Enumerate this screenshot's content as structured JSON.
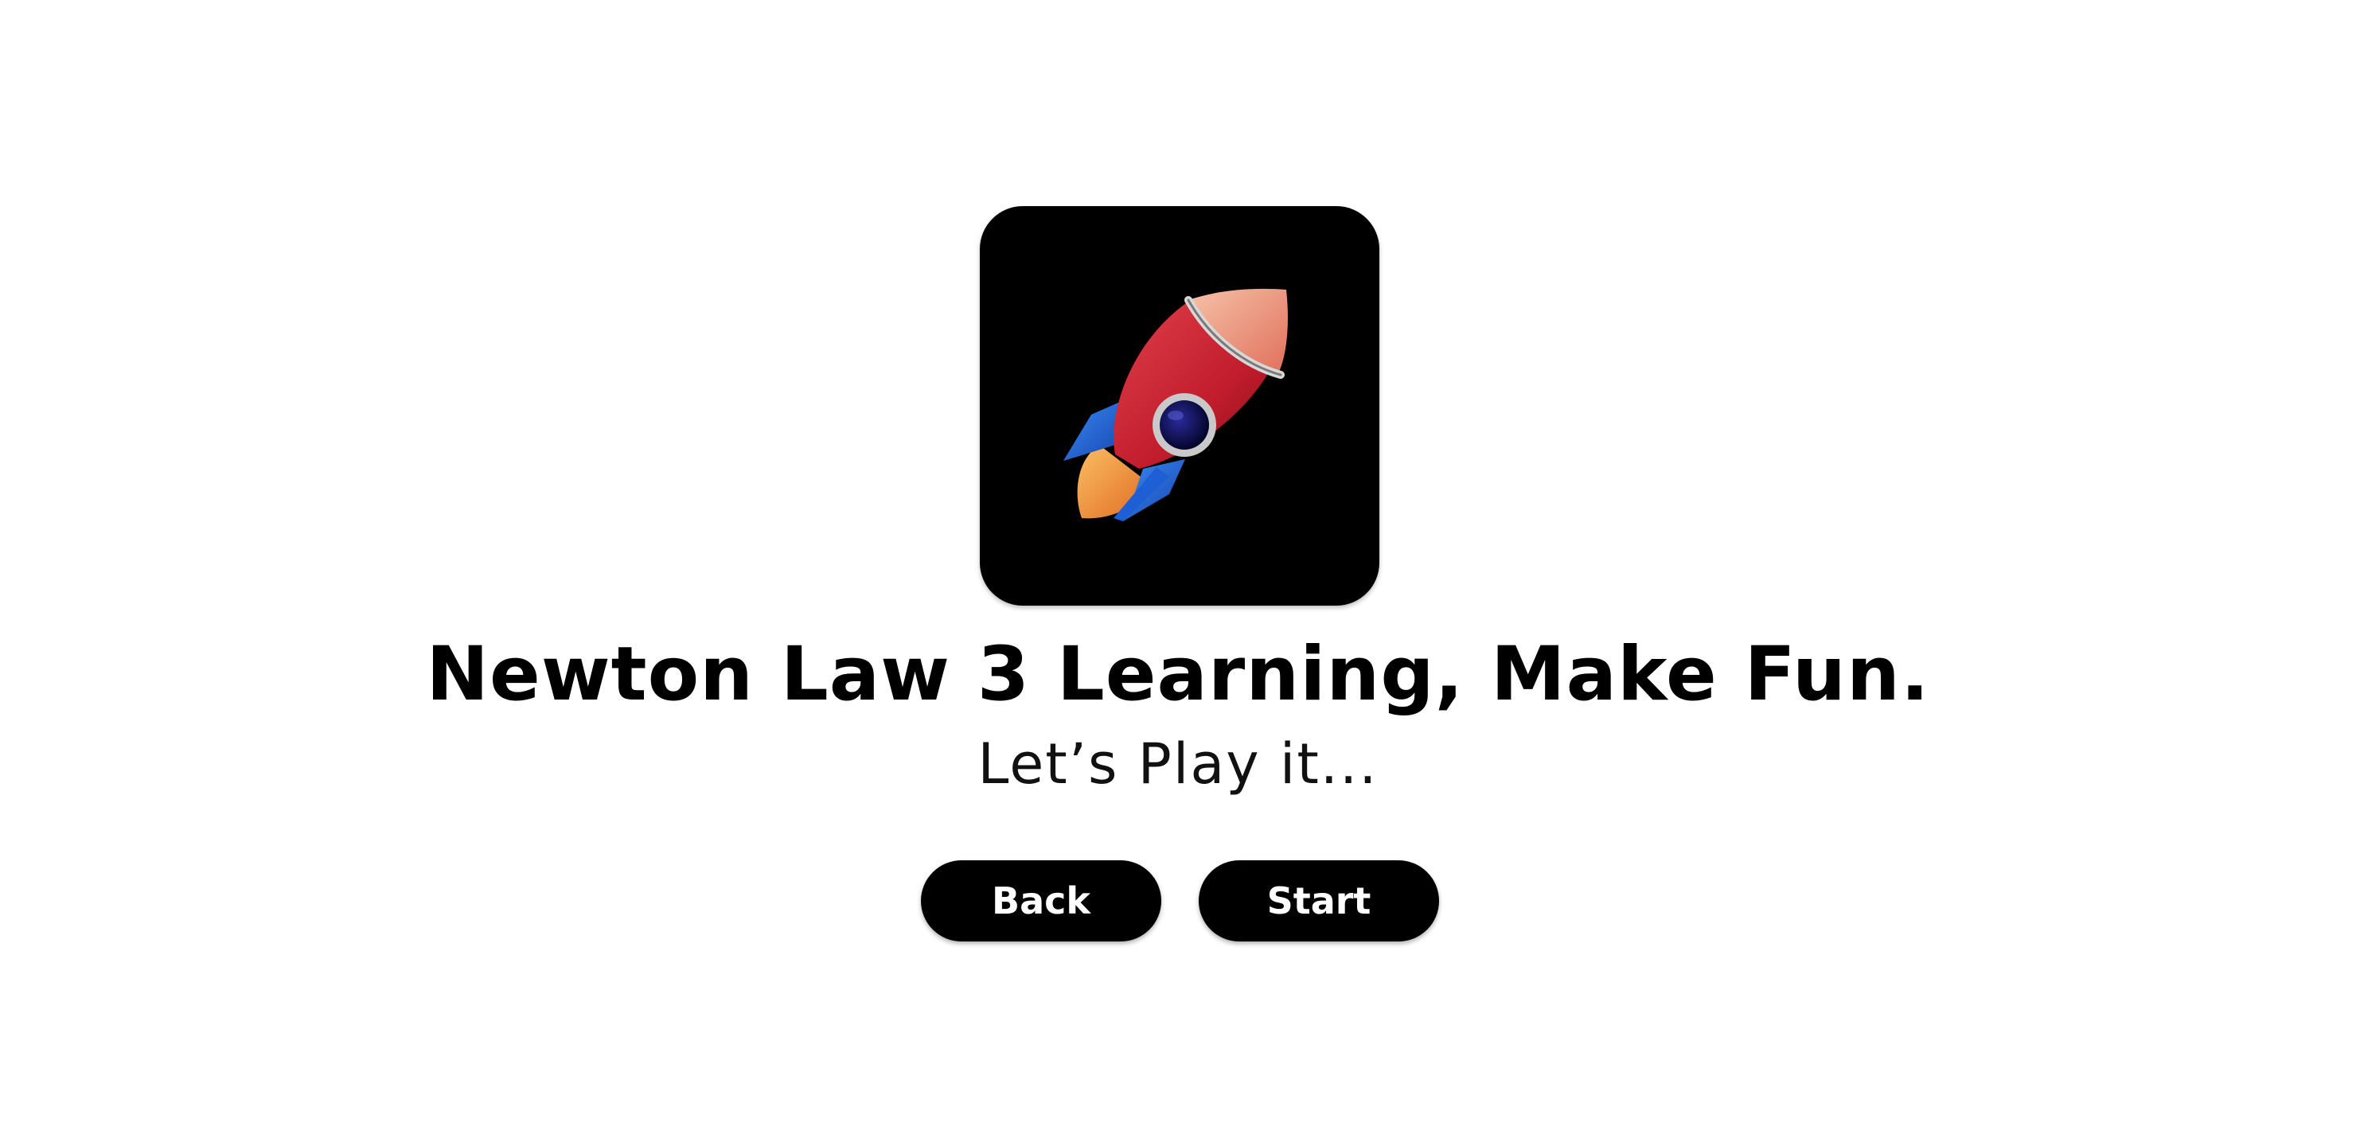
{
  "logo": {
    "icon": "rocket-icon",
    "background": "#000000"
  },
  "heading": {
    "title": "Newton Law 3 Learning, Make Fun.",
    "subtitle": "Let’s Play it..."
  },
  "actions": {
    "back_label": "Back",
    "start_label": "Start"
  },
  "colors": {
    "page_background": "#ffffff",
    "button_background": "#000000",
    "button_text": "#ffffff",
    "rocket_body": "#c8202f",
    "rocket_fins": "#1e5fd6",
    "rocket_flame": "#f39a3a",
    "rocket_window": "#0a0a4a"
  }
}
